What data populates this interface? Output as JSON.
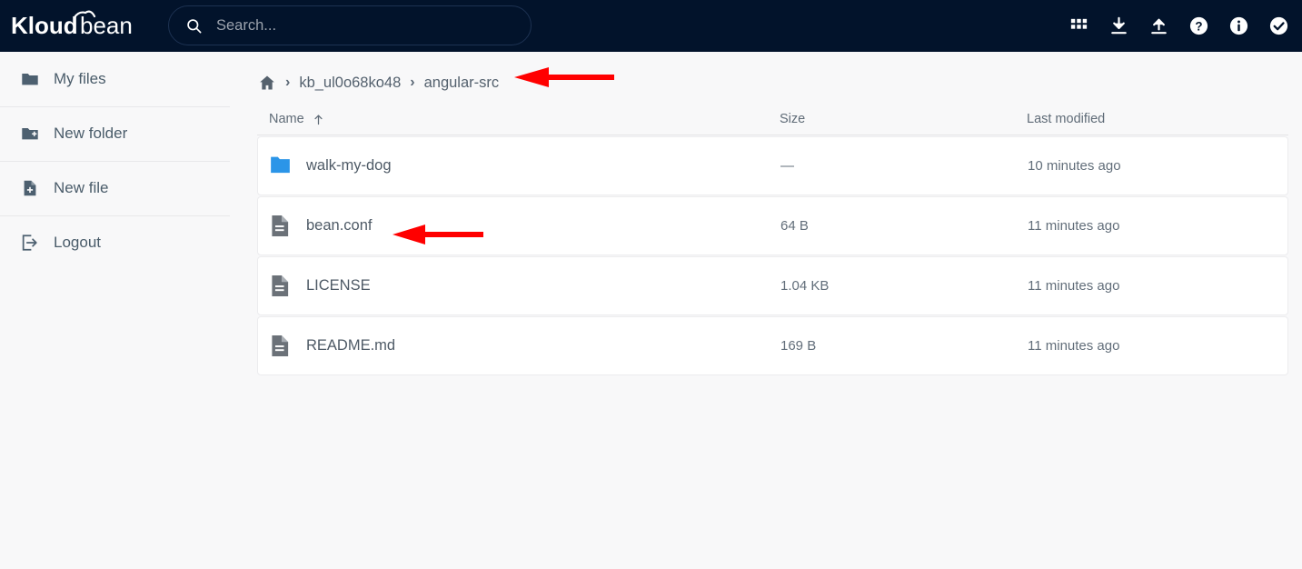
{
  "brand": {
    "name_bold": "Kloud",
    "name_light": "bean"
  },
  "search": {
    "placeholder": "Search...",
    "value": ""
  },
  "topbar": {
    "icons": [
      {
        "name": "apps-grid-icon",
        "label": "Apps"
      },
      {
        "name": "download-icon",
        "label": "Download"
      },
      {
        "name": "upload-icon",
        "label": "Upload"
      },
      {
        "name": "help-circle-icon",
        "label": "Help"
      },
      {
        "name": "info-circle-icon",
        "label": "Info"
      },
      {
        "name": "check-circle-icon",
        "label": "Status"
      }
    ],
    "background_color": "#02132b"
  },
  "sidebar": {
    "items": [
      {
        "label": "My files",
        "icon": "folder-icon"
      },
      {
        "label": "New folder",
        "icon": "folder-plus-icon"
      },
      {
        "label": "New file",
        "icon": "file-plus-icon"
      },
      {
        "label": "Logout",
        "icon": "logout-icon"
      }
    ]
  },
  "breadcrumb": {
    "home_icon": "home-icon",
    "separator": "›",
    "items": [
      {
        "label": "kb_ul0o68ko48"
      },
      {
        "label": "angular-src"
      }
    ]
  },
  "table": {
    "headers": {
      "name": "Name",
      "size": "Size",
      "modified": "Last modified"
    },
    "sort": {
      "column": "Name",
      "direction": "asc",
      "arrow": "↑"
    },
    "rows": [
      {
        "name": "walk-my-dog",
        "type": "folder",
        "icon": "folder-icon",
        "size": "—",
        "modified": "10 minutes ago"
      },
      {
        "name": "bean.conf",
        "type": "file",
        "icon": "file-icon",
        "size": "64 B",
        "modified": "11 minutes ago"
      },
      {
        "name": "LICENSE",
        "type": "file",
        "icon": "file-icon",
        "size": "1.04 KB",
        "modified": "11 minutes ago"
      },
      {
        "name": "README.md",
        "type": "file",
        "icon": "file-icon",
        "size": "169 B",
        "modified": "11 minutes ago"
      }
    ]
  },
  "annotations": [
    {
      "name": "breadcrumb-arrow",
      "color": "#ff0000",
      "direction": "left",
      "points_at": "angular-src"
    },
    {
      "name": "file-arrow",
      "color": "#ff0000",
      "direction": "left",
      "points_at": "bean.conf"
    }
  ],
  "colors": {
    "header_bg": "#02132b",
    "page_bg": "#f8f8f9",
    "row_bg": "#ffffff",
    "folder_blue": "#2b95e8",
    "file_gray": "#6b7178",
    "text_primary": "#4e5a66",
    "annotation_red": "#ff0000"
  }
}
